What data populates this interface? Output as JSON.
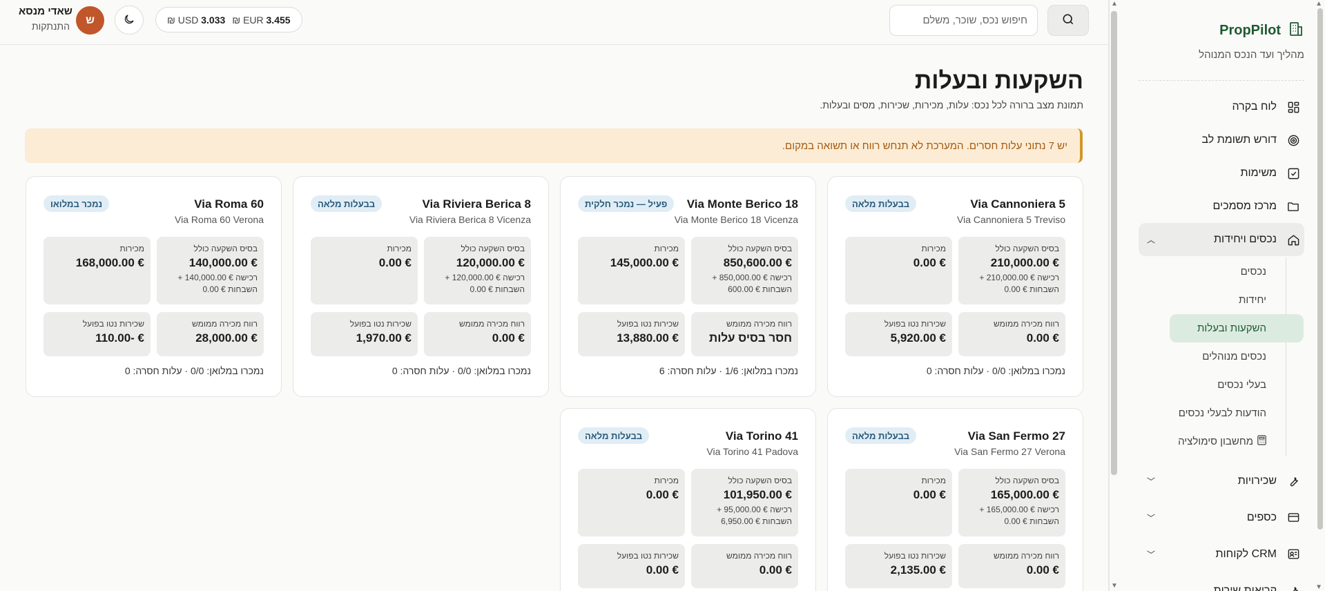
{
  "brand": {
    "title": "PropPilot",
    "subtitle": "מהליך ועד הנכס המנוהל"
  },
  "nav": {
    "items": [
      {
        "label": "לוח בקרה",
        "icon": "grid-icon"
      },
      {
        "label": "דורש תשומת לב",
        "icon": "target-icon"
      },
      {
        "label": "משימות",
        "icon": "checkbox-icon"
      },
      {
        "label": "מרכז מסמכים",
        "icon": "folder-icon"
      },
      {
        "label": "נכסים ויחידות",
        "icon": "home-icon"
      }
    ],
    "sub": [
      {
        "label": "נכסים"
      },
      {
        "label": "יחידות"
      },
      {
        "label": "השקעות ובעלות"
      },
      {
        "label": "נכסים מנוהלים"
      },
      {
        "label": "בעלי נכסים"
      },
      {
        "label": "הודעות לבעלי נכסים"
      },
      {
        "label": "מחשבון סימולציה"
      }
    ],
    "more": [
      {
        "label": "שכירויות",
        "icon": "wrench-icon"
      },
      {
        "label": "כספים",
        "icon": "card-icon"
      },
      {
        "label": "CRM לקוחות",
        "icon": "contact-card-icon"
      },
      {
        "label": "קריאות שירות",
        "icon": "tool-icon"
      }
    ]
  },
  "topbar": {
    "search_placeholder": "חיפוש נכס, שוכר, משלם",
    "user_name": "שאדי מנסא",
    "logout": "התנתקות",
    "avatar_initial": "ש",
    "fx": {
      "eur_label": "EUR",
      "eur_value": "3.455",
      "usd_label": "USD",
      "usd_value": "3.033",
      "currency": "₪"
    }
  },
  "page": {
    "title": "השקעות ובעלות",
    "subtitle": "תמונת מצב ברורה לכל נכס: עלות, מכירות, שכירות, מסים ובעלות.",
    "alert": "יש 7 נתוני עלות חסרים. המערכת לא תנחש רווח או תשואה במקום."
  },
  "labels": {
    "basis": "בסיס השקעה כולל",
    "sales": "מכירות",
    "profit": "רווח מכירה ממומש",
    "rent": "שכירות נטו בפועל"
  },
  "cards": [
    {
      "name": "Via Cannoniera 5",
      "addr": "Via Cannoniera 5 Treviso",
      "badge": "בבעלות מלאה",
      "basis": "210,000.00 €",
      "basis_note": "רכישה € 210,000.00 + השבחות € 0.00",
      "sales": "0.00 €",
      "profit": "0.00 €",
      "rent": "5,920.00 €",
      "foot": "נמכרו במלואן: 0/0 · עלות חסרה: 0"
    },
    {
      "name": "Via Monte Berico 18",
      "addr": "Via Monte Berico 18 Vicenza",
      "badge": "פעיל — נמכר חלקית",
      "basis": "850,600.00 €",
      "basis_note": "רכישה € 850,000.00 + השבחות € 600.00",
      "sales": "145,000.00 €",
      "profit": "חסר בסיס עלות",
      "rent": "13,880.00 €",
      "foot": "נמכרו במלואן: 1/6 · עלות חסרה: 6"
    },
    {
      "name": "Via Riviera Berica 8",
      "addr": "Via Riviera Berica 8 Vicenza",
      "badge": "בבעלות מלאה",
      "basis": "120,000.00 €",
      "basis_note": "רכישה € 120,000.00 + השבחות € 0.00",
      "sales": "0.00 €",
      "profit": "0.00 €",
      "rent": "1,970.00 €",
      "foot": "נמכרו במלואן: 0/0 · עלות חסרה: 0"
    },
    {
      "name": "Via Roma 60",
      "addr": "Via Roma 60 Verona",
      "badge": "נמכר במלואו",
      "basis": "140,000.00 €",
      "basis_note": "רכישה € 140,000.00 + השבחות € 0.00",
      "sales": "168,000.00 €",
      "profit": "28,000.00 €",
      "rent": "110.00- €",
      "foot": "נמכרו במלואן: 0/0 · עלות חסרה: 0"
    },
    {
      "name": "Via San Fermo 27",
      "addr": "Via San Fermo 27 Verona",
      "badge": "בבעלות מלאה",
      "basis": "165,000.00 €",
      "basis_note": "רכישה € 165,000.00 + השבחות € 0.00",
      "sales": "0.00 €",
      "profit": "0.00 €",
      "rent": "2,135.00 €",
      "foot": ""
    },
    {
      "name": "Via Torino 41",
      "addr": "Via Torino 41 Padova",
      "badge": "בבעלות מלאה",
      "basis": "101,950.00 €",
      "basis_note": "רכישה € 95,000.00 + השבחות € 6,950.00",
      "sales": "0.00 €",
      "profit": "0.00 €",
      "rent": "0.00 €",
      "foot": ""
    }
  ]
}
